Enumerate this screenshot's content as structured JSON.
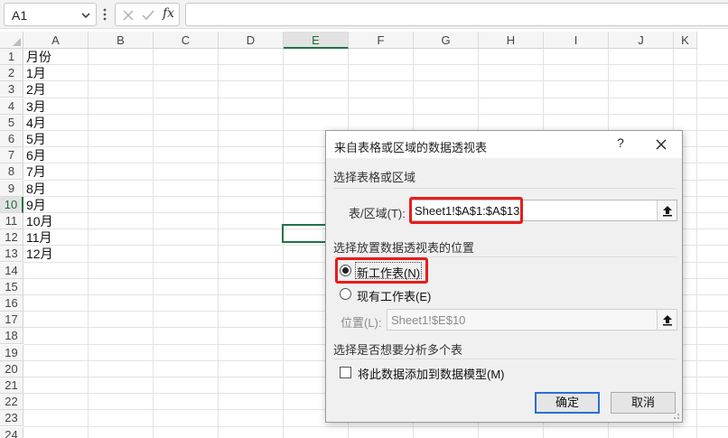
{
  "formula_bar": {
    "name_box": "A1",
    "fx_label": "fx",
    "formula": ""
  },
  "grid": {
    "columns": [
      "A",
      "B",
      "C",
      "D",
      "E",
      "F",
      "G",
      "H",
      "I",
      "J",
      "K"
    ],
    "selected_column": "E",
    "rows": [
      "1",
      "2",
      "3",
      "4",
      "5",
      "6",
      "7",
      "8",
      "9",
      "10",
      "11",
      "12",
      "13",
      "14",
      "15",
      "16",
      "17",
      "18",
      "19",
      "20",
      "21",
      "22",
      "23",
      "24"
    ],
    "selected_row": "10",
    "column_a_values": [
      "月份",
      "1月",
      "2月",
      "3月",
      "4月",
      "5月",
      "6月",
      "7月",
      "8月",
      "9月",
      "10月",
      "11月",
      "12月"
    ]
  },
  "dialog": {
    "title": "来自表格或区域的数据透视表",
    "help": "?",
    "section1": "选择表格或区域",
    "range_label": "表/区域(T):",
    "range_value": "Sheet1!$A$1:$A$13",
    "section2": "选择放置数据透视表的位置",
    "radio_new": "新工作表(N)",
    "radio_existing": "现有工作表(E)",
    "radio_selected": "new",
    "location_label": "位置(L):",
    "location_value": "Sheet1!$E$10",
    "section3": "选择是否想要分析多个表",
    "checkbox_label": "将此数据添加到数据模型(M)",
    "checkbox_checked": false,
    "ok_label": "确定",
    "cancel_label": "取消"
  },
  "colors": {
    "accent_green": "#217346",
    "highlight_red": "#e81c1c",
    "default_button_blue": "#2a6fd0"
  }
}
